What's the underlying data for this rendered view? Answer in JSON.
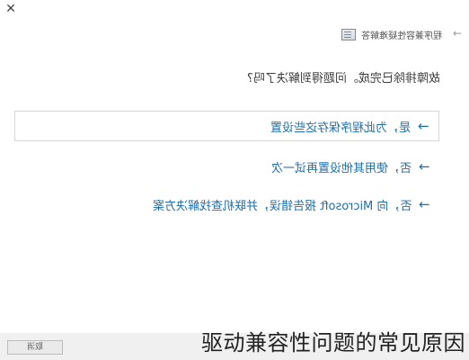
{
  "window": {
    "title": "程序兼容性疑难解答",
    "close_icon": "close-icon",
    "back_icon": "back-arrow-icon"
  },
  "main": {
    "question": "故障排除已完成。问题得到解决了吗?",
    "options": [
      {
        "arrow_icon": "arrow-right-icon",
        "label": "是，为此程序保存这些设置"
      },
      {
        "arrow_icon": "arrow-right-icon",
        "label": "否，使用其他设置再试一次"
      },
      {
        "arrow_icon": "arrow-right-icon",
        "label": "否，向 Microsoft 报告错误，并联机查找解决方案"
      }
    ]
  },
  "footer": {
    "cancel_label": "取消"
  },
  "watermark": {
    "text": "驱动兼容性问题的常见原因"
  },
  "colors": {
    "link_blue": "#1f6fa8",
    "footer_gray": "#f0f0f0",
    "border_gray": "#d8d8d8"
  }
}
